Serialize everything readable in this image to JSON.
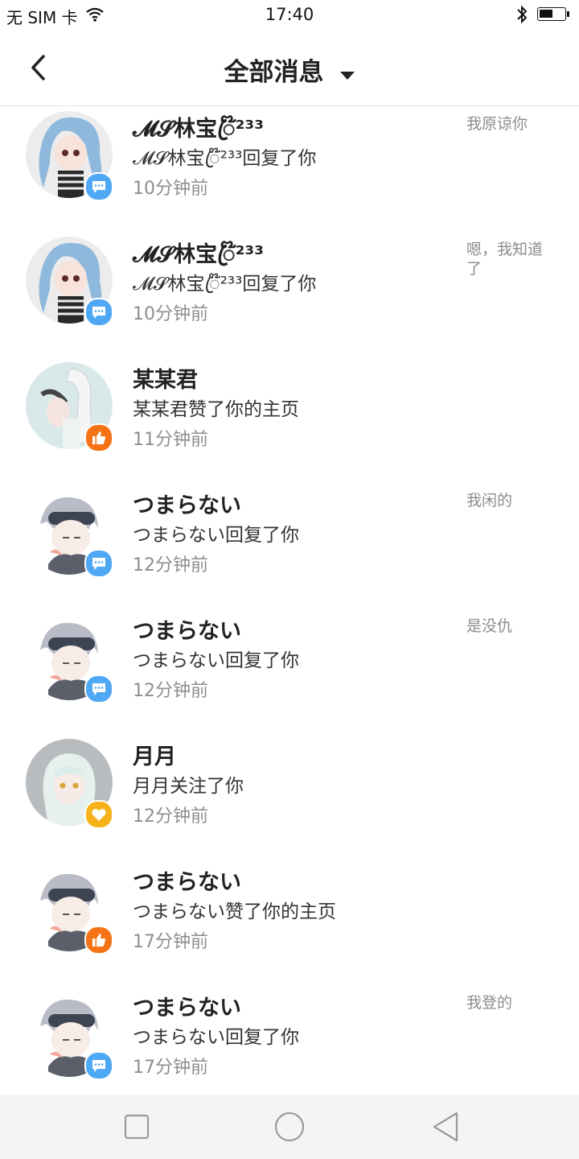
{
  "status_bar": {
    "carrier": "无 SIM 卡",
    "time": "17:40",
    "icons": [
      "wifi-icon",
      "bluetooth-icon",
      "battery-icon"
    ]
  },
  "header": {
    "title": "全部消息",
    "back_icon": "chevron-left-icon",
    "dropdown_icon": "caret-down-icon"
  },
  "colors": {
    "comment_badge": "#4fa8f4",
    "like_badge": "#f57314",
    "follow_badge": "#f7b21a",
    "secondary_text": "#8e8e8e",
    "divider": "#e3e3e3"
  },
  "messages": [
    {
      "name": "𝓜𝓢林宝ꦿ໊²³³",
      "action": "𝓜𝓢林宝ꦿ໊²³³回复了你",
      "time": "10分钟前",
      "preview": "我原谅你",
      "type": "comment",
      "avatar": "blue-hair"
    },
    {
      "name": "𝓜𝓢林宝ꦿ໊²³³",
      "action": "𝓜𝓢林宝ꦿ໊²³³回复了你",
      "time": "10分钟前",
      "preview": "嗯，我知道了",
      "type": "comment",
      "avatar": "blue-hair"
    },
    {
      "name": "某某君",
      "action": "某某君赞了你的主页",
      "time": "11分钟前",
      "preview": "",
      "type": "like",
      "avatar": "white-hair"
    },
    {
      "name": "つまらない",
      "action": "つまらない回复了你",
      "time": "12分钟前",
      "preview": "我闲的",
      "type": "comment",
      "avatar": "silver-boy"
    },
    {
      "name": "つまらない",
      "action": "つまらない回复了你",
      "time": "12分钟前",
      "preview": "是没仇",
      "type": "comment",
      "avatar": "silver-boy"
    },
    {
      "name": "月月",
      "action": "月月关注了你",
      "time": "12分钟前",
      "preview": "",
      "type": "follow",
      "avatar": "mint-girl"
    },
    {
      "name": "つまらない",
      "action": "つまらない赞了你的主页",
      "time": "17分钟前",
      "preview": "",
      "type": "like",
      "avatar": "silver-boy"
    },
    {
      "name": "つまらない",
      "action": "つまらない回复了你",
      "time": "17分钟前",
      "preview": "我登的",
      "type": "comment",
      "avatar": "silver-boy"
    }
  ],
  "nav_bar": {
    "buttons": [
      "square-recents-icon",
      "circle-home-icon",
      "triangle-back-icon"
    ]
  }
}
